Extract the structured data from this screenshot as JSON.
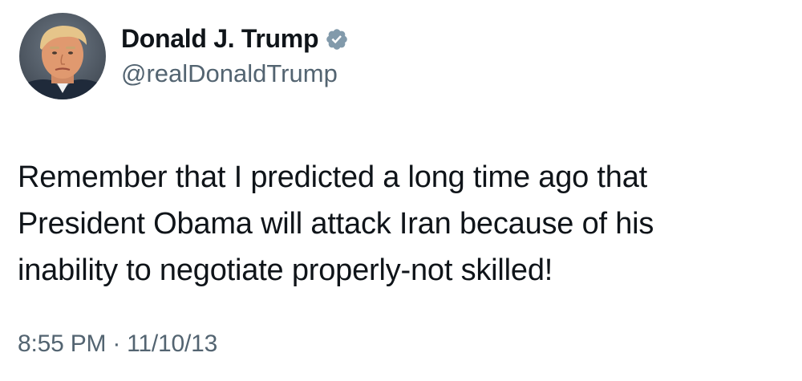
{
  "author": {
    "display_name": "Donald J. Trump",
    "handle": "@realDonaldTrump",
    "verified_icon": "verified-badge-icon",
    "verified_color": "#829aab"
  },
  "tweet": {
    "text": "Remember that I predicted a long time ago that\nPresident Obama will attack Iran because of his\ninability to negotiate properly-not skilled!",
    "time": "8:55 PM",
    "separator": "·",
    "date": "11/10/13"
  },
  "colors": {
    "primary_text": "#0f1419",
    "secondary_text": "#536471",
    "background": "#ffffff"
  }
}
